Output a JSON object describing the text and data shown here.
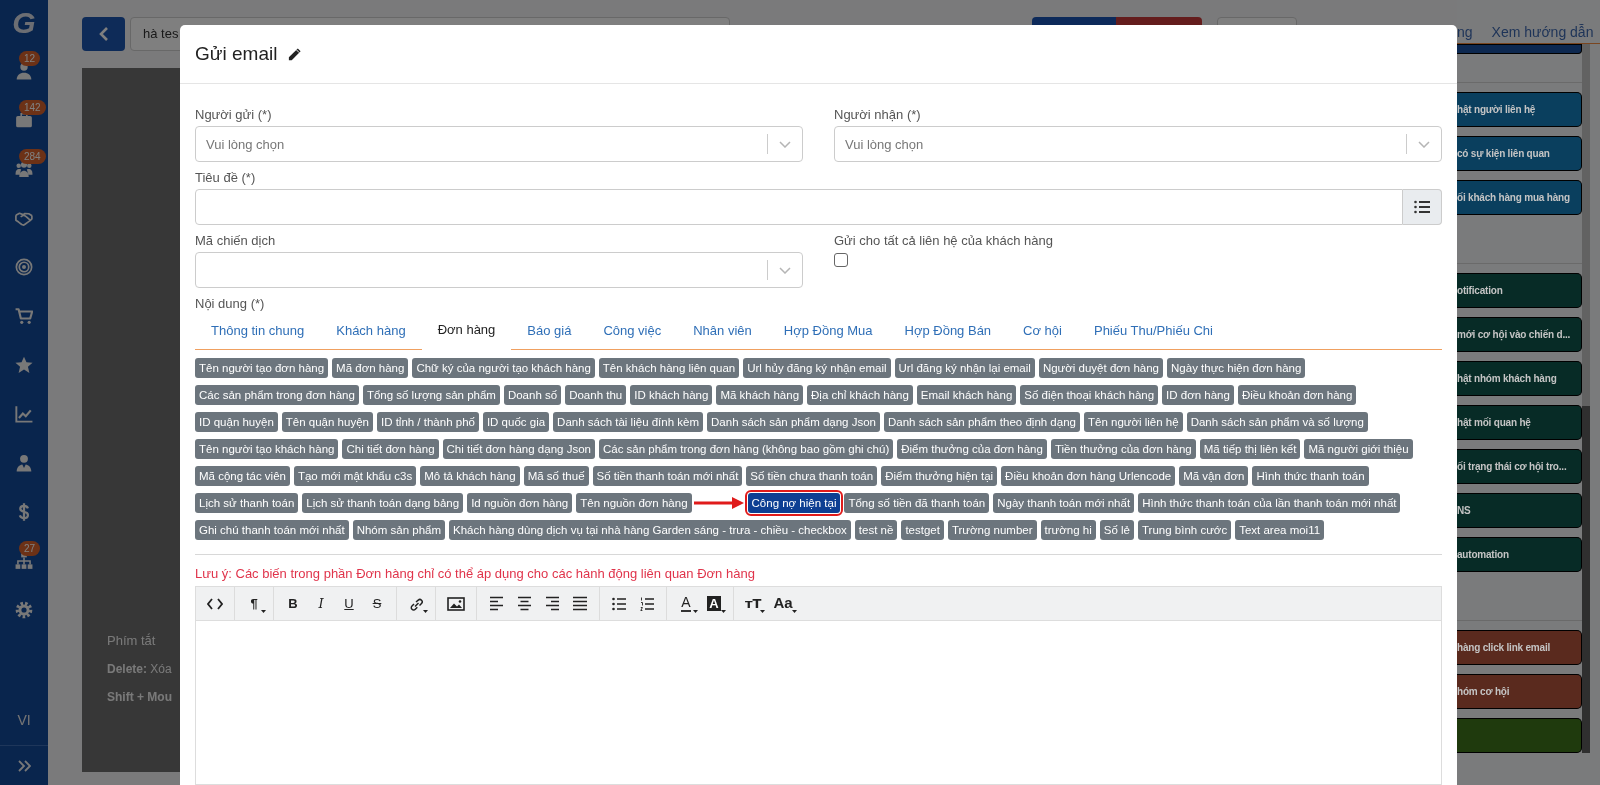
{
  "sidebar": {
    "logo": "G",
    "items": [
      {
        "kind": "user",
        "badge": "12"
      },
      {
        "kind": "briefcase",
        "badge": "142"
      },
      {
        "kind": "users",
        "badge": "284"
      },
      {
        "kind": "handshake"
      },
      {
        "kind": "target"
      },
      {
        "kind": "cart"
      },
      {
        "kind": "star"
      },
      {
        "kind": "chart"
      },
      {
        "kind": "user-tie"
      },
      {
        "kind": "dollar"
      },
      {
        "kind": "sitemap",
        "badge": "27"
      },
      {
        "kind": "gear"
      }
    ],
    "language": "VI"
  },
  "topbar": {
    "search_value": "hà tes",
    "links": [
      "ng",
      "Xem hướng dẫn"
    ]
  },
  "canvas": {
    "shortcuts_title": "Phím tắt",
    "shortcut_lines": [
      "**Delete:** Xóa",
      "**Shift + Mou**"
    ]
  },
  "side_panel": {
    "groups": [
      {
        "cards": [
          {
            "color": "#0d2850"
          }
        ]
      },
      {
        "cards": [
          {
            "label": "hật người liên hệ",
            "color": "#0a3f5e"
          },
          {
            "label": "có sự kiện liên quan",
            "color": "#0a3f5e"
          },
          {
            "label": "ối khách hàng mua hàng",
            "color": "#0a3f5e"
          }
        ]
      },
      {
        "cards": [
          {
            "label": "otification",
            "color": "#072b26"
          },
          {
            "label": "mới cơ hội vào chiến d...",
            "color": "#072b26"
          },
          {
            "label": "hật nhóm khách hàng",
            "color": "#072b26"
          },
          {
            "label": "hật mối quan hệ",
            "color": "#072b26"
          },
          {
            "label": "ối trạng thái cơ hội tro...",
            "color": "#072b26"
          },
          {
            "label": "NS",
            "color": "#072b26"
          },
          {
            "label": "automation",
            "color": "#072b26"
          }
        ]
      },
      {
        "cards": [
          {
            "label": "hàng click link email",
            "color": "#5a2a1e"
          },
          {
            "label": "hóm cơ hội",
            "color": "#5a2a1e"
          },
          {
            "color": "#1f3a0d"
          }
        ]
      }
    ]
  },
  "modal": {
    "title": "Gửi email",
    "sender": {
      "label": "Người gửi (*)",
      "placeholder": "Vui lòng chọn"
    },
    "recipient": {
      "label": "Người nhận (*)",
      "placeholder": "Vui lòng chọn"
    },
    "subject": {
      "label": "Tiêu đề (*)"
    },
    "campaign": {
      "label": "Mã chiến dịch"
    },
    "send_all": {
      "label": "Gửi cho tất cả liên hệ của khách hàng",
      "checked": false
    },
    "content_label": "Nội dung (*)",
    "tabs": [
      {
        "label": "Thông tin chung",
        "selected": false
      },
      {
        "label": "Khách hàng",
        "selected": false
      },
      {
        "label": "Đơn hàng",
        "selected": true
      },
      {
        "label": "Báo giá",
        "selected": false
      },
      {
        "label": "Công việc",
        "selected": false
      },
      {
        "label": "Nhân viên",
        "selected": false
      },
      {
        "label": "Hợp Đồng Mua",
        "selected": false
      },
      {
        "label": "Hợp Đồng Bán",
        "selected": false
      },
      {
        "label": "Cơ hội",
        "selected": false
      },
      {
        "label": "Phiếu Thu/Phiếu Chi",
        "selected": false
      }
    ],
    "tag_rows": [
      [
        {
          "label": "Tên người tạo đơn hàng",
          "selected": false
        },
        {
          "label": "Mã đơn hàng",
          "selected": false
        },
        {
          "label": "Chữ ký của người tạo khách hàng",
          "selected": false
        },
        {
          "label": "Tên khách hàng liên quan",
          "selected": false
        },
        {
          "label": "Url hủy đăng ký nhận email",
          "selected": false
        },
        {
          "label": "Url đăng ký nhận lại email",
          "selected": false
        },
        {
          "label": "Người duyệt đơn hàng",
          "selected": false
        },
        {
          "label": "Ngày thực hiện đơn hàng",
          "selected": false
        }
      ],
      [
        {
          "label": "Các sản phẩm trong đơn hàng",
          "selected": false
        },
        {
          "label": "Tổng số lượng sản phẩm",
          "selected": false
        },
        {
          "label": "Doanh số",
          "selected": false
        },
        {
          "label": "Doanh thu",
          "selected": false
        },
        {
          "label": "ID khách hàng",
          "selected": false
        },
        {
          "label": "Mã khách hàng",
          "selected": false
        },
        {
          "label": "Địa chỉ khách hàng",
          "selected": false
        },
        {
          "label": "Email khách hàng",
          "selected": false
        },
        {
          "label": "Số điện thoại khách hàng",
          "selected": false
        },
        {
          "label": "ID đơn hàng",
          "selected": false
        },
        {
          "label": "Điều khoản đơn hàng",
          "selected": false
        }
      ],
      [
        {
          "label": "ID quận huyện",
          "selected": false
        },
        {
          "label": "Tên quận huyện",
          "selected": false
        },
        {
          "label": "ID tỉnh / thành phố",
          "selected": false
        },
        {
          "label": "ID quốc gia",
          "selected": false
        },
        {
          "label": "Danh sách tài liệu đính kèm",
          "selected": false
        },
        {
          "label": "Danh sách sản phẩm dạng Json",
          "selected": false
        },
        {
          "label": "Danh sách sản phẩm theo định dạng",
          "selected": false
        },
        {
          "label": "Tên người liên hệ",
          "selected": false
        },
        {
          "label": "Danh sách sản phẩm và số lượng",
          "selected": false
        }
      ],
      [
        {
          "label": "Tên người tạo khách hàng",
          "selected": false
        },
        {
          "label": "Chi tiết đơn hàng",
          "selected": false
        },
        {
          "label": "Chi tiết đơn hàng dạng Json",
          "selected": false
        },
        {
          "label": "Các sản phẩm trong đơn hàng (không bao gồm ghi chú)",
          "selected": false
        },
        {
          "label": "Điểm thưởng của đơn hàng",
          "selected": false
        },
        {
          "label": "Tiền thưởng của đơn hàng",
          "selected": false
        },
        {
          "label": "Mã tiếp thị liên kết",
          "selected": false
        },
        {
          "label": "Mã người giới thiệu",
          "selected": false
        }
      ],
      [
        {
          "label": "Mã cộng tác viên",
          "selected": false
        },
        {
          "label": "Tạo mới mật khẩu c3s",
          "selected": false
        },
        {
          "label": "Mô tả khách hàng",
          "selected": false
        },
        {
          "label": "Mã số thuế",
          "selected": false
        },
        {
          "label": "Số tiền thanh toán mới nhất",
          "selected": false
        },
        {
          "label": "Số tiền chưa thanh toán",
          "selected": false
        },
        {
          "label": "Điểm thưởng hiện tại",
          "selected": false
        },
        {
          "label": "Điều khoản đơn hàng Urlencode",
          "selected": false
        },
        {
          "label": "Mã vận đơn",
          "selected": false
        },
        {
          "label": "Hình thức thanh toán",
          "selected": false
        }
      ],
      [
        {
          "label": "Lịch sử thanh toán",
          "selected": false
        },
        {
          "label": "Lịch sử thanh toán dạng bảng",
          "selected": false
        },
        {
          "label": "Id nguồn đơn hàng",
          "selected": false
        },
        {
          "label": "Tên nguồn đơn hàng",
          "selected": false
        },
        {
          "label": "Công nợ hiện tại",
          "selected": true
        },
        {
          "label": "Tổng số tiền đã thanh toán",
          "selected": false
        },
        {
          "label": "Ngày thanh toán mới nhất",
          "selected": false
        },
        {
          "label": "Hình thức thanh toán của lần thanh toán mới nhất",
          "selected": false
        }
      ],
      [
        {
          "label": "Ghi chú thanh toán mới nhất",
          "selected": false
        },
        {
          "label": "Nhóm sản phẩm",
          "selected": false
        },
        {
          "label": "Khách hàng dùng dịch vụ tại nhà hàng Garden sáng - trưa - chiều - checkbox",
          "selected": false
        },
        {
          "label": "test nề",
          "selected": false
        },
        {
          "label": "testget",
          "selected": false
        },
        {
          "label": "Trường number",
          "selected": false
        },
        {
          "label": "trường hi",
          "selected": false
        },
        {
          "label": "Số lẻ",
          "selected": false
        },
        {
          "label": "Trung bình cước",
          "selected": false
        },
        {
          "label": "Text area moi11",
          "selected": false
        }
      ]
    ],
    "note": "Lưu ý: Các biến trong phần Đơn hàng chỉ có thể áp dụng cho các hành động liên quan Đơn hàng",
    "toolbar": [
      [
        {
          "kind": "code",
          "dropdown": false
        }
      ],
      [
        {
          "kind": "paragraph",
          "glyph": "¶",
          "dropdown": true
        }
      ],
      [
        {
          "kind": "bold",
          "glyph": "B",
          "dropdown": false
        },
        {
          "kind": "italic",
          "glyph": "I",
          "dropdown": false
        },
        {
          "kind": "underline",
          "glyph": "U",
          "dropdown": false
        },
        {
          "kind": "strike",
          "glyph": "S",
          "dropdown": false
        }
      ],
      [
        {
          "kind": "link",
          "dropdown": true
        }
      ],
      [
        {
          "kind": "image",
          "dropdown": false
        }
      ],
      [
        {
          "kind": "align-left",
          "dropdown": false
        },
        {
          "kind": "align-center",
          "dropdown": false
        },
        {
          "kind": "align-right",
          "dropdown": false
        },
        {
          "kind": "justify",
          "dropdown": false
        }
      ],
      [
        {
          "kind": "bullet-list",
          "dropdown": false
        },
        {
          "kind": "numbered-list",
          "dropdown": false
        }
      ],
      [
        {
          "kind": "font-color",
          "glyph": "A",
          "dropdown": true
        },
        {
          "kind": "highlight",
          "glyph": "A",
          "dropdown": true
        }
      ],
      [
        {
          "kind": "font-size",
          "glyph": "ᴛT",
          "dropdown": true
        },
        {
          "kind": "font-style",
          "glyph": "Aa",
          "dropdown": true
        }
      ]
    ]
  }
}
